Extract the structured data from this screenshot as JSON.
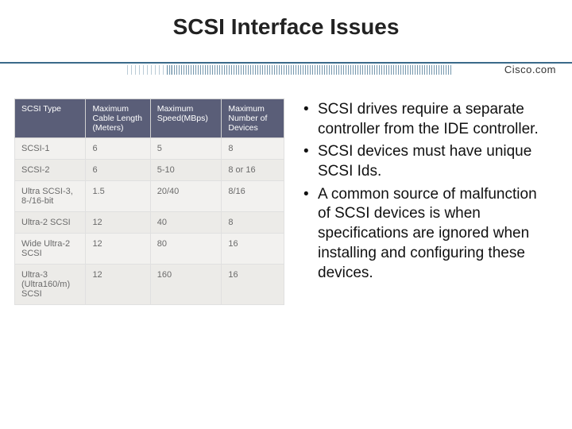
{
  "title": "SCSI Interface Issues",
  "brand": "Cisco.com",
  "table": {
    "headers": [
      "SCSI Type",
      "Maximum Cable Length (Meters)",
      "Maximum Speed(MBps)",
      "Maximum Number of Devices"
    ],
    "rows": [
      [
        "SCSI-1",
        "6",
        "5",
        "8"
      ],
      [
        "SCSI-2",
        "6",
        "5-10",
        "8 or 16"
      ],
      [
        "Ultra SCSI-3, 8-/16-bit",
        "1.5",
        "20/40",
        "8/16"
      ],
      [
        "Ultra-2 SCSI",
        "12",
        "40",
        "8"
      ],
      [
        "Wide Ultra-2 SCSI",
        "12",
        "80",
        "16"
      ],
      [
        "Ultra-3 (Ultra160/m) SCSI",
        "12",
        "160",
        "16"
      ]
    ]
  },
  "bullets": [
    "SCSI drives require a separate controller from the IDE controller.",
    "SCSI devices must have unique SCSI Ids.",
    "A common source of malfunction of SCSI devices is when specifications are ignored when installing and configuring these devices."
  ],
  "chart_data": {
    "type": "table",
    "title": "SCSI Interface Issues",
    "columns": [
      "SCSI Type",
      "Maximum Cable Length (Meters)",
      "Maximum Speed(MBps)",
      "Maximum Number of Devices"
    ],
    "rows": [
      {
        "SCSI Type": "SCSI-1",
        "Maximum Cable Length (Meters)": 6,
        "Maximum Speed(MBps)": "5",
        "Maximum Number of Devices": "8"
      },
      {
        "SCSI Type": "SCSI-2",
        "Maximum Cable Length (Meters)": 6,
        "Maximum Speed(MBps)": "5-10",
        "Maximum Number of Devices": "8 or 16"
      },
      {
        "SCSI Type": "Ultra SCSI-3, 8-/16-bit",
        "Maximum Cable Length (Meters)": 1.5,
        "Maximum Speed(MBps)": "20/40",
        "Maximum Number of Devices": "8/16"
      },
      {
        "SCSI Type": "Ultra-2 SCSI",
        "Maximum Cable Length (Meters)": 12,
        "Maximum Speed(MBps)": "40",
        "Maximum Number of Devices": "8"
      },
      {
        "SCSI Type": "Wide Ultra-2 SCSI",
        "Maximum Cable Length (Meters)": 12,
        "Maximum Speed(MBps)": "80",
        "Maximum Number of Devices": "16"
      },
      {
        "SCSI Type": "Ultra-3 (Ultra160/m) SCSI",
        "Maximum Cable Length (Meters)": 12,
        "Maximum Speed(MBps)": "160",
        "Maximum Number of Devices": "16"
      }
    ]
  }
}
